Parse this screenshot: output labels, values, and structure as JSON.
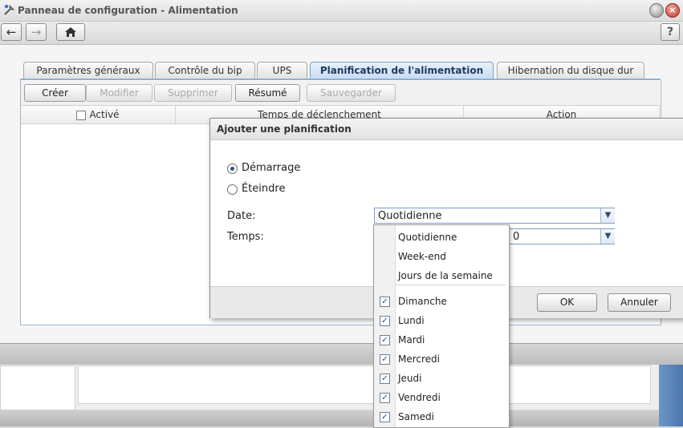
{
  "window": {
    "title": "Panneau de configuration - Alimentation"
  },
  "nav": {
    "back": "←",
    "forward": "→",
    "help": "?"
  },
  "tabs": [
    {
      "label": "Paramètres généraux"
    },
    {
      "label": "Contrôle du bip"
    },
    {
      "label": "UPS"
    },
    {
      "label": "Planification de l'alimentation"
    },
    {
      "label": "Hibernation du disque dur"
    }
  ],
  "toolbar": {
    "create": "Créer",
    "modify": "Modifier",
    "delete": "Supprimer",
    "summary": "Résumé",
    "save": "Sauvegarder"
  },
  "grid": {
    "col_enabled": "Activé",
    "col_trigger": "Temps de déclenchement",
    "col_action": "Action"
  },
  "dialog": {
    "title": "Ajouter une planification",
    "radio_startup": "Démarrage",
    "radio_shutdown": "Éteindre",
    "selected_radio": "Démarrage",
    "date_label": "Date:",
    "date_value": "Quotidienne",
    "time_label": "Temps:",
    "time_value_visible": "0",
    "ok": "OK",
    "cancel": "Annuler"
  },
  "dropdown": {
    "presets": [
      "Quotidienne",
      "Week-end",
      "Jours de la semaine"
    ],
    "days": [
      {
        "label": "Dimanche",
        "checked": true
      },
      {
        "label": "Lundi",
        "checked": true
      },
      {
        "label": "Mardi",
        "checked": true
      },
      {
        "label": "Mercredi",
        "checked": true
      },
      {
        "label": "Jeudi",
        "checked": true
      },
      {
        "label": "Vendredi",
        "checked": true
      },
      {
        "label": "Samedi",
        "checked": true
      }
    ]
  }
}
